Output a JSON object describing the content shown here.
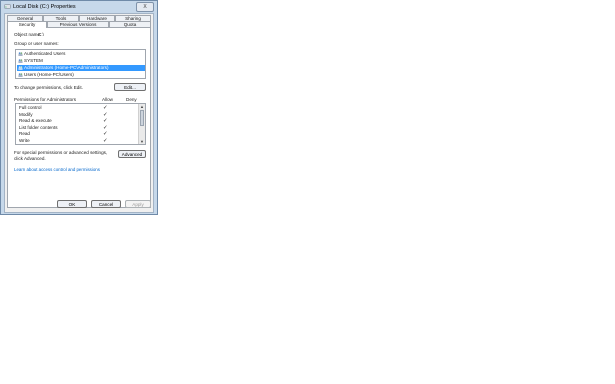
{
  "window": {
    "title": "Local Disk (C:) Properties",
    "close_label": "X"
  },
  "tabs_row1": [
    "General",
    "Tools",
    "Hardware",
    "Sharing"
  ],
  "tabs_row2": [
    "Security",
    "Previous Versions",
    "Quota"
  ],
  "active_tab": "Security",
  "object": {
    "label": "Object name:",
    "value": "C:\\"
  },
  "groups": {
    "label": "Group or user names:",
    "items": [
      "Authenticated Users",
      "SYSTEM",
      "Administrators (Home-PC\\Administrators)",
      "Users (Home-PC\\Users)"
    ],
    "selected_index": 2
  },
  "change_perm": {
    "text": "To change permissions, click Edit.",
    "button": "Edit..."
  },
  "permissions": {
    "label": "Permissions for Administrators",
    "allow_header": "Allow",
    "deny_header": "Deny",
    "rows": [
      {
        "name": "Full control",
        "allow": "✓"
      },
      {
        "name": "Modify",
        "allow": "✓"
      },
      {
        "name": "Read & execute",
        "allow": "✓"
      },
      {
        "name": "List folder contents",
        "allow": "✓"
      },
      {
        "name": "Read",
        "allow": "✓"
      },
      {
        "name": "Write",
        "allow": "✓"
      }
    ]
  },
  "special": {
    "line1": "For special permissions or advanced settings,",
    "line2": "click Advanced.",
    "button": "Advanced"
  },
  "learn_link": "Learn about access control and permissions",
  "footer": {
    "ok": "OK",
    "cancel": "Cancel",
    "apply": "Apply"
  },
  "colors": {
    "selection": "#3399ff",
    "link": "#0066cc",
    "frame": "#c6d8ea"
  }
}
